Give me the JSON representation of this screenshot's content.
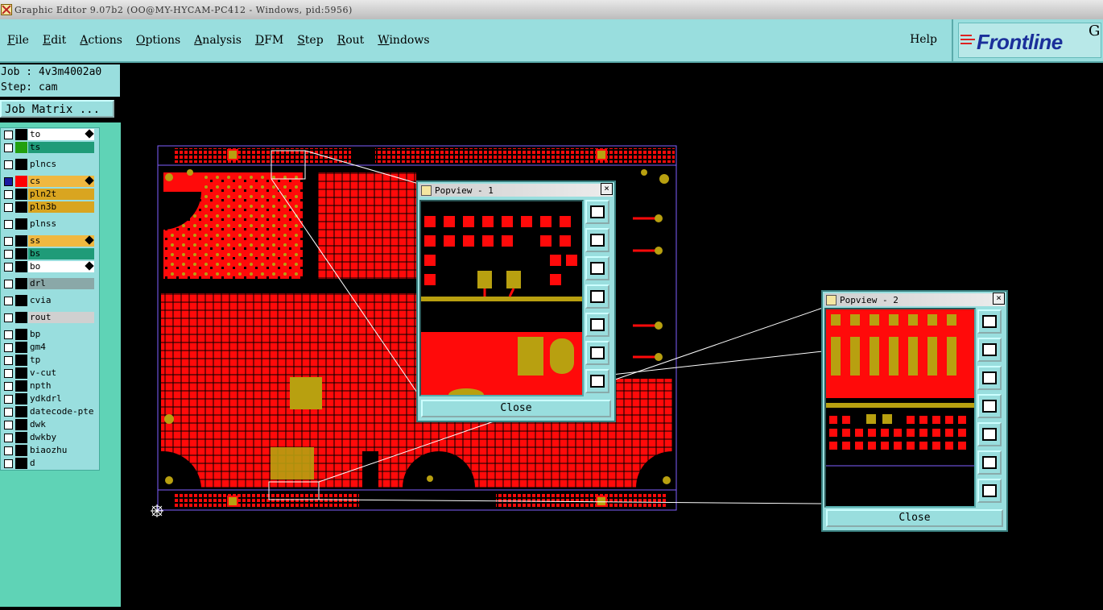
{
  "window": {
    "title": "Graphic Editor 9.07b2 (OO@MY-HYCAM-PC412 - Windows, pid:5956)"
  },
  "menu": {
    "items": [
      "File",
      "Edit",
      "Actions",
      "Options",
      "Analysis",
      "DFM",
      "Step",
      "Rout",
      "Windows"
    ],
    "help": "Help"
  },
  "brand": {
    "logo_text": "Frontline",
    "suffix": "G"
  },
  "job": {
    "job_line": "Job : 4v3m4002a0",
    "step_line": "Step: cam",
    "matrix_button": "Job Matrix ..."
  },
  "layers": [
    {
      "name": "to",
      "color": "#ffffff",
      "swatch": "#000000",
      "selected": true,
      "pencil": true
    },
    {
      "name": "ts",
      "color": "#1f9b78",
      "swatch": "#22a010"
    },
    {
      "name": "plncs",
      "color": "#99dede",
      "swatch": "#000000"
    },
    {
      "name": "cs",
      "color": "#f0b840",
      "swatch": "#ff0000",
      "active": true,
      "pencil": true
    },
    {
      "name": "pln2t",
      "color": "#d9a520",
      "swatch": "#000000"
    },
    {
      "name": "pln3b",
      "color": "#d9a520",
      "swatch": "#000000"
    },
    {
      "name": "plnss",
      "color": "#99dede",
      "swatch": "#000000"
    },
    {
      "name": "ss",
      "color": "#f0b840",
      "swatch": "#000000",
      "pencil": true
    },
    {
      "name": "bs",
      "color": "#1f9b78",
      "swatch": "#000000"
    },
    {
      "name": "bo",
      "color": "#ffffff",
      "swatch": "#000000",
      "pencil": true
    },
    {
      "name": "drl",
      "color": "#8aa8a8",
      "swatch": "#000000"
    },
    {
      "name": "cvia",
      "color": "#99dede",
      "swatch": "#000000"
    },
    {
      "name": "rout",
      "color": "#d0d0d0",
      "swatch": "#000000"
    },
    {
      "name": "bp",
      "color": "#99dede",
      "swatch": "#000000"
    },
    {
      "name": "gm4",
      "color": "#99dede",
      "swatch": "#000000"
    },
    {
      "name": "tp",
      "color": "#99dede",
      "swatch": "#000000"
    },
    {
      "name": "v-cut",
      "color": "#99dede",
      "swatch": "#000000"
    },
    {
      "name": "npth",
      "color": "#99dede",
      "swatch": "#000000"
    },
    {
      "name": "ydkdrl",
      "color": "#99dede",
      "swatch": "#000000"
    },
    {
      "name": "datecode-pte",
      "color": "#99dede",
      "swatch": "#000000"
    },
    {
      "name": "dwk",
      "color": "#99dede",
      "swatch": "#000000"
    },
    {
      "name": "dwkby",
      "color": "#99dede",
      "swatch": "#000000"
    },
    {
      "name": "biaozhu",
      "color": "#99dede",
      "swatch": "#000000"
    },
    {
      "name": "d",
      "color": "#99dede",
      "swatch": "#000000"
    }
  ],
  "popview1": {
    "title": "Popview - 1",
    "close_label": "Close",
    "close_x": "×"
  },
  "popview2": {
    "title": "Popview - 2",
    "close_label": "Close",
    "close_x": "×"
  },
  "colors": {
    "copper": "#ff0a0a",
    "pad": "#b8a010",
    "outline": "#8060ff"
  }
}
